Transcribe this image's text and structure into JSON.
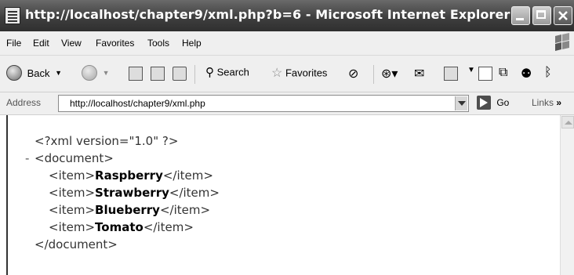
{
  "window": {
    "title": "http://localhost/chapter9/xml.php?b=6 - Microsoft Internet Explorer"
  },
  "menu": [
    "File",
    "Edit",
    "View",
    "Favorites",
    "Tools",
    "Help"
  ],
  "toolbar": {
    "back_label": "Back",
    "search_label": "Search",
    "favorites_label": "Favorites"
  },
  "address": {
    "label": "Address",
    "url": "http://localhost/chapter9/xml.php",
    "go_label": "Go",
    "links_label": "Links"
  },
  "content": {
    "declaration": "<?xml version=\"1.0\" ?>",
    "collapse_marker": "-",
    "root_open": "<document>",
    "root_close": "</document>",
    "item_open": "<item>",
    "item_close": "</item>",
    "items": [
      "Raspberry",
      "Strawberry",
      "Blueberry",
      "Tomato"
    ]
  }
}
